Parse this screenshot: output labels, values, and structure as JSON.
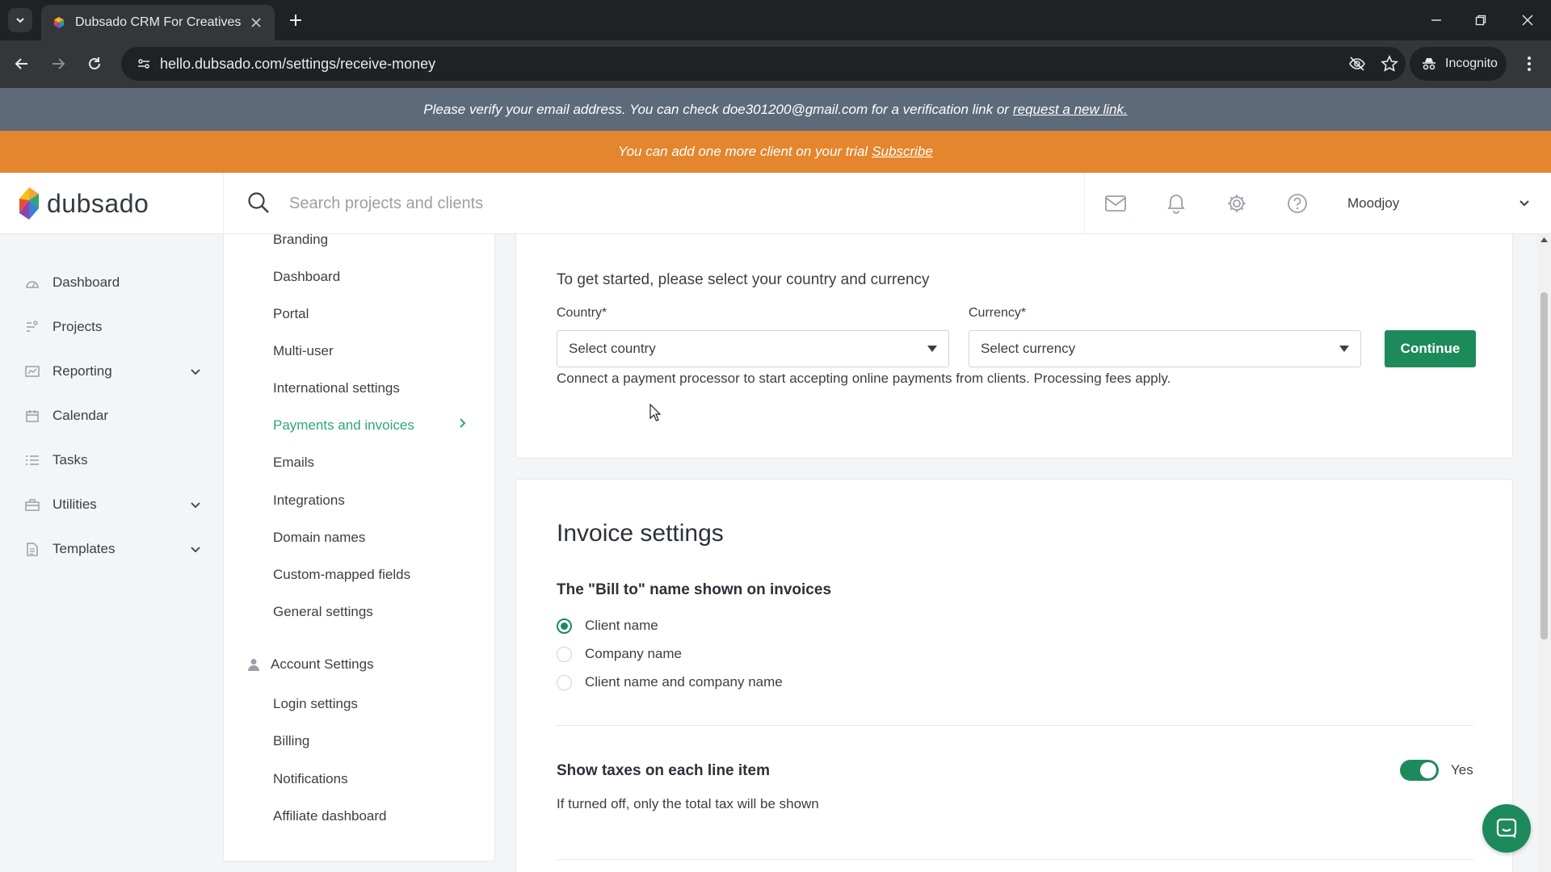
{
  "browser": {
    "tab_title": "Dubsado CRM For Creatives",
    "url": "hello.dubsado.com/settings/receive-money",
    "incognito_label": "Incognito"
  },
  "banners": {
    "verify_text": "Please verify your email address. You can check doe301200@gmail.com for a verification link or",
    "verify_link": "request a new link.",
    "trial_text": "You can add one more client on your trial",
    "trial_link": "Subscribe"
  },
  "header": {
    "logo_text": "dubsado",
    "search_placeholder": "Search projects and clients",
    "user_name": "Moodjoy"
  },
  "sidebar": {
    "items": [
      {
        "label": "Dashboard",
        "icon": "dashboard-icon",
        "has_chevron": false
      },
      {
        "label": "Projects",
        "icon": "projects-icon",
        "has_chevron": false
      },
      {
        "label": "Reporting",
        "icon": "reporting-icon",
        "has_chevron": true
      },
      {
        "label": "Calendar",
        "icon": "calendar-icon",
        "has_chevron": false
      },
      {
        "label": "Tasks",
        "icon": "tasks-icon",
        "has_chevron": false
      },
      {
        "label": "Utilities",
        "icon": "utilities-icon",
        "has_chevron": true
      },
      {
        "label": "Templates",
        "icon": "templates-icon",
        "has_chevron": true
      }
    ]
  },
  "settings_nav": {
    "items": [
      {
        "label": "Branding"
      },
      {
        "label": "Dashboard"
      },
      {
        "label": "Portal"
      },
      {
        "label": "Multi-user"
      },
      {
        "label": "International settings"
      },
      {
        "label": "Payments and invoices",
        "active": true
      },
      {
        "label": "Emails"
      },
      {
        "label": "Integrations"
      },
      {
        "label": "Domain names"
      },
      {
        "label": "Custom-mapped fields"
      },
      {
        "label": "General settings"
      }
    ],
    "account_heading": "Account Settings",
    "account_items": [
      {
        "label": "Login settings"
      },
      {
        "label": "Billing"
      },
      {
        "label": "Notifications"
      },
      {
        "label": "Affiliate dashboard"
      }
    ]
  },
  "payment_setup": {
    "title": "To get started, please select your country and currency",
    "country_label": "Country*",
    "country_value": "Select country",
    "currency_label": "Currency*",
    "currency_value": "Select currency",
    "continue_label": "Continue",
    "description": "Connect a payment processor to start accepting online payments from clients. Processing fees apply."
  },
  "invoice_settings": {
    "title": "Invoice settings",
    "bill_to_heading": "The \"Bill to\" name shown on invoices",
    "bill_to_options": [
      {
        "label": "Client name",
        "selected": true
      },
      {
        "label": "Company name",
        "selected": false
      },
      {
        "label": "Client name and company name",
        "selected": false
      }
    ],
    "taxes_heading": "Show taxes on each line item",
    "taxes_toggle_on": true,
    "taxes_toggle_label": "Yes",
    "taxes_note": "If turned off, only the total tax will be shown"
  },
  "colors": {
    "accent": "#1d8a5b",
    "active_link": "#2ea776",
    "verify_banner": "#5d6a7a",
    "trial_banner": "#e3862e"
  }
}
